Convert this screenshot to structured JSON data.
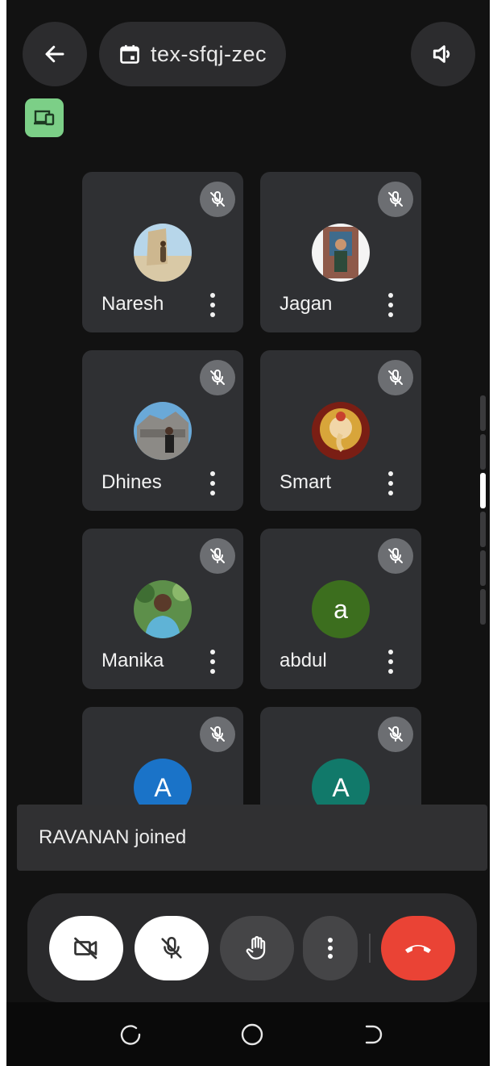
{
  "header": {
    "meeting_code": "tex-sfqj-zec",
    "icons": {
      "back": "arrow-left-icon",
      "calendar": "calendar-icon",
      "audio": "speaker-icon",
      "device": "devices-icon"
    }
  },
  "participants": [
    {
      "name": "Naresh",
      "avatar": "photo",
      "muted": true
    },
    {
      "name": "Jagan",
      "avatar": "photo",
      "muted": true
    },
    {
      "name": "Dhines",
      "avatar": "photo",
      "muted": true
    },
    {
      "name": "Smart",
      "avatar": "photo",
      "muted": true
    },
    {
      "name": "Manika",
      "avatar": "photo",
      "muted": true
    },
    {
      "name": "abdul",
      "avatar": "letter",
      "initial": "a",
      "color": "#3c6e1e",
      "muted": true
    },
    {
      "name": "",
      "avatar": "letter",
      "initial": "A",
      "color": "#1a73c8",
      "muted": true
    },
    {
      "name": "",
      "avatar": "letter",
      "initial": "A",
      "color": "#11796a",
      "muted": true
    }
  ],
  "notification": {
    "text": "RAVANAN joined"
  },
  "controls": {
    "video": "video-off-icon",
    "mic": "mic-off-icon",
    "raise_hand": "hand-icon",
    "more": "more-vert-icon",
    "end_call": "end-call-icon",
    "end_call_color": "#ea4335"
  },
  "nav": {
    "recents": "recents-icon",
    "home": "home-icon",
    "back": "back-icon"
  },
  "scroll": {
    "segments": 6,
    "active_index": 2
  }
}
